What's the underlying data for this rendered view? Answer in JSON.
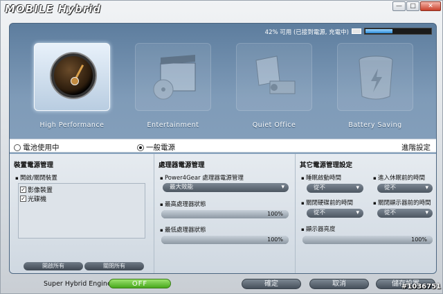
{
  "title_bar": {
    "logo_text": "MOBILE Hybrid",
    "minimize": "—",
    "maximize": "□",
    "close": "✕"
  },
  "battery": {
    "status_text": "42% 可用 (已接到電源, 充電中)",
    "level_percent": 42
  },
  "modes": [
    {
      "label": "High Performance",
      "active": true
    },
    {
      "label": "Entertainment",
      "active": false
    },
    {
      "label": "Quiet Office",
      "active": false
    },
    {
      "label": "Battery Saving",
      "active": false
    }
  ],
  "power_source": {
    "battery": "電池使用中",
    "ac": "一般電源",
    "selected": "ac",
    "advanced": "進階設定"
  },
  "device_power": {
    "title": "裝置電源管理",
    "section": "開啟/關閉裝置",
    "items": [
      {
        "label": "影像裝置",
        "checked": true
      },
      {
        "label": "光碟機",
        "checked": true
      }
    ],
    "open_all": "開啟所有",
    "close_all": "關閉所有"
  },
  "cpu_power": {
    "title": "處理器電源管理",
    "gear_label": "Power4Gear 處理器電源管理",
    "gear_value": "最大效能",
    "max_label": "最高處理器狀態",
    "max_value": "100%",
    "max_level": 100,
    "min_label": "最低處理器狀態",
    "min_value": "100%",
    "min_level": 100
  },
  "other_power": {
    "title": "其它電源管理設定",
    "sleep_label": "睡眠啟動時間",
    "sleep_value": "從不",
    "hibernate_label": "進入休眠前的時間",
    "hibernate_value": "從不",
    "disk_label": "關閉硬碟前的時間",
    "disk_value": "從不",
    "display_label": "關閉顯示器前的時間",
    "display_value": "從不",
    "brightness_label": "顯示器亮度",
    "brightness_value": "100%",
    "brightness_level": 100
  },
  "bottom": {
    "she_label": "Super Hybrid Engine",
    "she_state": "OFF",
    "ok": "確定",
    "cancel": "取消",
    "save": "儲存設置"
  },
  "watermark": "#1036751"
}
